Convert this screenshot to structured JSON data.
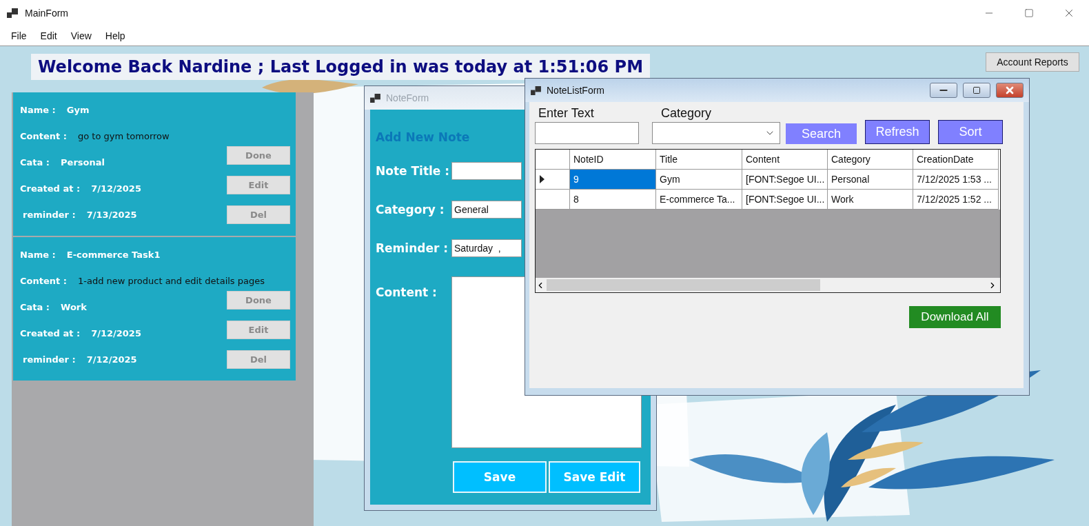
{
  "window": {
    "title": "MainForm"
  },
  "menu": [
    "File",
    "Edit",
    "View",
    "Help"
  ],
  "welcome": "Welcome Back Nardine ; Last Logged in was today at 1:51:06 PM",
  "account_reports_button": "Account Reports",
  "notes": [
    {
      "fields": [
        {
          "label": "Name :",
          "value": "Gym",
          "kind": "bold"
        },
        {
          "label": "Content :",
          "value": "go to gym tomorrow",
          "kind": "plain"
        },
        {
          "label": "Cata :",
          "value": "Personal",
          "kind": "bold"
        },
        {
          "label": "Created at :",
          "value": "7/12/2025",
          "kind": "bold"
        },
        {
          "label": "reminder  :",
          "value": "7/13/2025",
          "kind": "bold"
        }
      ],
      "buttons": [
        {
          "label": "Done",
          "disabled": true
        },
        {
          "label": "Edit",
          "disabled": true
        },
        {
          "label": "Del",
          "disabled": true
        }
      ]
    },
    {
      "fields": [
        {
          "label": "Name :",
          "value": "E-commerce Task1",
          "kind": "bold"
        },
        {
          "label": "Content :",
          "value": "1-add new product and edit details pages",
          "kind": "plain"
        },
        {
          "label": "Cata :",
          "value": "Work",
          "kind": "bold"
        },
        {
          "label": "Created at :",
          "value": "7/12/2025",
          "kind": "bold"
        },
        {
          "label": "reminder  :",
          "value": "7/12/2025",
          "kind": "bold"
        }
      ],
      "buttons": [
        {
          "label": "Done",
          "disabled": true
        },
        {
          "label": "Edit",
          "disabled": true
        },
        {
          "label": "Del",
          "disabled": true
        }
      ]
    }
  ],
  "note_form": {
    "title": "NoteForm",
    "active": false,
    "heading": "Add New Note",
    "fields": [
      {
        "label": "Note Title :",
        "kind": "text"
      },
      {
        "label": "Category :",
        "kind": "text",
        "value": "General"
      },
      {
        "label": "Reminder :",
        "kind": "text",
        "value": "Saturday  ,"
      },
      {
        "label": "Content :",
        "kind": "textarea"
      }
    ],
    "buttons": [
      "Save",
      "Save Edit"
    ]
  },
  "note_list_form": {
    "title": "NoteListForm",
    "active": true,
    "search_label": "Enter Text",
    "category_label": "Category",
    "buttons": [
      {
        "label": "Search",
        "focused": false
      },
      {
        "label": "Refresh",
        "focused": true
      },
      {
        "label": "Sort",
        "focused": true
      }
    ],
    "columns": [
      "NoteID",
      "Title",
      "Content",
      "Category",
      "CreationDate"
    ],
    "rows": [
      {
        "selected": true,
        "cells": [
          "9",
          "Gym",
          "[FONT:Segoe UI...",
          "Personal",
          "7/12/2025 1:53 ..."
        ]
      },
      {
        "selected": false,
        "cells": [
          "8",
          "E-commerce Ta...",
          "[FONT:Segoe UI...",
          "Work",
          "7/12/2025 1:52 ..."
        ]
      }
    ],
    "download_button": "Download All"
  }
}
